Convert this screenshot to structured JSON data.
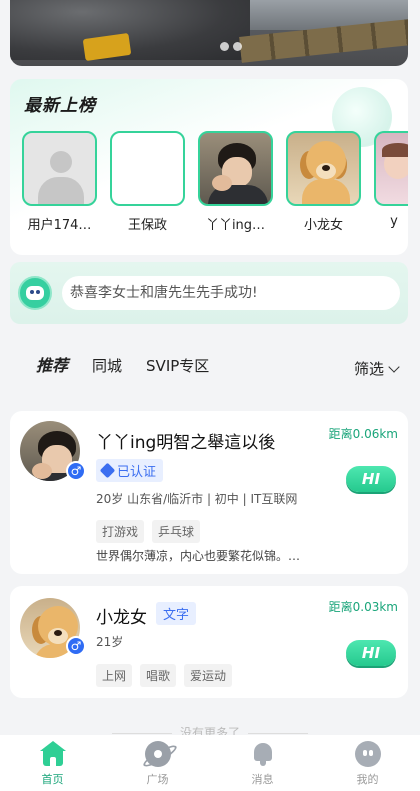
{
  "latest_list": {
    "title": "最新上榜",
    "users": [
      {
        "name": "用户174…",
        "avatar": "default-avatar"
      },
      {
        "name": "王保政",
        "avatar": "blank-avatar"
      },
      {
        "name": "丫丫ing…",
        "avatar": "girl-photo"
      },
      {
        "name": "小龙女",
        "avatar": "dog-photo"
      },
      {
        "name": "y",
        "avatar": "kid-photo"
      }
    ]
  },
  "notice": {
    "text": "恭喜李女士和唐先生先手成功!"
  },
  "tabs": {
    "items": [
      "推荐",
      "同城",
      "SVIP专区"
    ],
    "active": "推荐",
    "filter_label": "筛选"
  },
  "cards": [
    {
      "name": "丫丫ing明智之舉這以後",
      "gender": "♂",
      "verified_label": "已认证",
      "distance": "距离0.06km",
      "info": "20岁  山东省/临沂市 | 初中 | IT互联网",
      "tags": [
        "打游戏",
        "乒乓球"
      ],
      "bio": "世界偶尔薄凉，内心也要繁花似锦。…",
      "hi_label": "HI"
    },
    {
      "name": "小龙女",
      "gender": "♂",
      "badge": "文字",
      "distance": "距离0.03km",
      "age": "21岁",
      "tags": [
        "上网",
        "唱歌",
        "爱运动"
      ],
      "hi_label": "HI"
    }
  ],
  "no_more_text": "没有更多了",
  "bottom_nav": {
    "items": [
      {
        "label": "首页",
        "icon": "home-icon",
        "active": true
      },
      {
        "label": "广场",
        "icon": "plaza-icon",
        "active": false
      },
      {
        "label": "消息",
        "icon": "bell-icon",
        "active": false
      },
      {
        "label": "我的",
        "icon": "me-icon",
        "active": false
      }
    ]
  },
  "colors": {
    "accent": "#2fcf95",
    "distance_green": "#1aa57a",
    "verified_blue": "#3b6ef0",
    "gender_blue": "#2f6cf4"
  }
}
